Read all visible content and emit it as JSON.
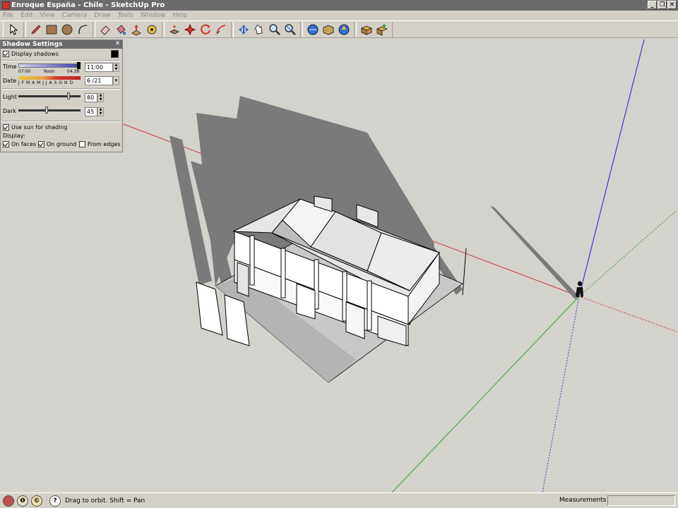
{
  "window": {
    "title": "Enroque España - Chile - SketchUp Pro"
  },
  "menu": [
    "File",
    "Edit",
    "View",
    "Camera",
    "Draw",
    "Tools",
    "Window",
    "Help"
  ],
  "toolbar": {
    "icons": [
      "select-icon",
      "pencil-icon",
      "rectangle-icon",
      "circle-icon",
      "arc-icon",
      "eraser-icon",
      "paint-bucket-icon",
      "push-pull-icon",
      "move-icon",
      "rotate-icon",
      "offset-icon",
      "orbit-icon",
      "pan-icon",
      "zoom-icon",
      "zoom-extents-icon",
      "previous-view-icon",
      "next-view-icon",
      "3d-warehouse-icon",
      "components-icon",
      "share-model-icon"
    ]
  },
  "shadow_settings": {
    "title": "Shadow Settings",
    "display_shadows": {
      "label": "Display shadows",
      "checked": true
    },
    "time": {
      "label": "Time",
      "start": "07:00",
      "noon": "Noon",
      "end": "04:38",
      "value": "11:00"
    },
    "date": {
      "label": "Date",
      "months": "J F M A M J J A S O N D",
      "value": "6 /21"
    },
    "light": {
      "label": "Light",
      "value": "80"
    },
    "dark": {
      "label": "Dark",
      "value": "45"
    },
    "use_sun": {
      "label": "Use sun for shading",
      "checked": true
    },
    "display_label": "Display:",
    "on_faces": {
      "label": "On faces",
      "checked": true
    },
    "on_ground": {
      "label": "On ground",
      "checked": true
    },
    "from_edges": {
      "label": "From edges",
      "checked": false
    }
  },
  "status": {
    "hint": "Drag to orbit.  Shift = Pan",
    "measurements_label": "Measurements"
  },
  "colors": {
    "red_axis": "#c83c3c",
    "green_axis": "#2fa82f",
    "blue_axis": "#3a3ad0",
    "shadow": "#7a7a7a",
    "ground": "#d4d2cc"
  }
}
